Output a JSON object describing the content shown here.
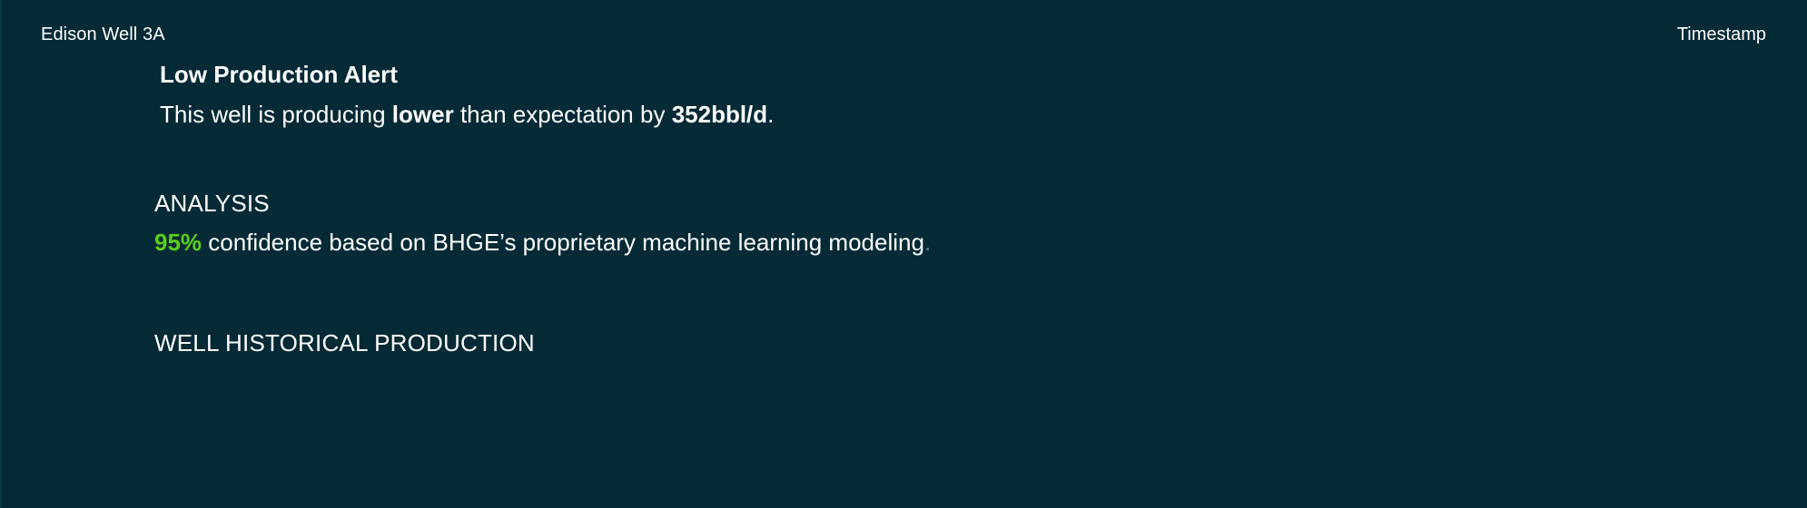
{
  "header": {
    "well_name": "Edison Well 3A",
    "timestamp_label": "Timestamp"
  },
  "alert": {
    "title": "Low Production Alert",
    "message_prefix": "This well is producing",
    "message_emphasis": "lower",
    "message_middle": "than expectation by",
    "deficit_value": "352bbl/d",
    "message_suffix": "."
  },
  "analysis": {
    "heading": "ANALYSIS",
    "confidence_value": "95%",
    "confidence_text": "confidence based on BHGE’s proprietary machine learning modeling",
    "trailing_period": ".",
    "confidence_color": "#5ccf1a"
  },
  "history": {
    "heading": "WELL HISTORICAL PRODUCTION"
  },
  "colors": {
    "background": "#042a36",
    "text": "#ffffff",
    "accent_green": "#5ccf1a",
    "muted": "#5f7d86"
  }
}
